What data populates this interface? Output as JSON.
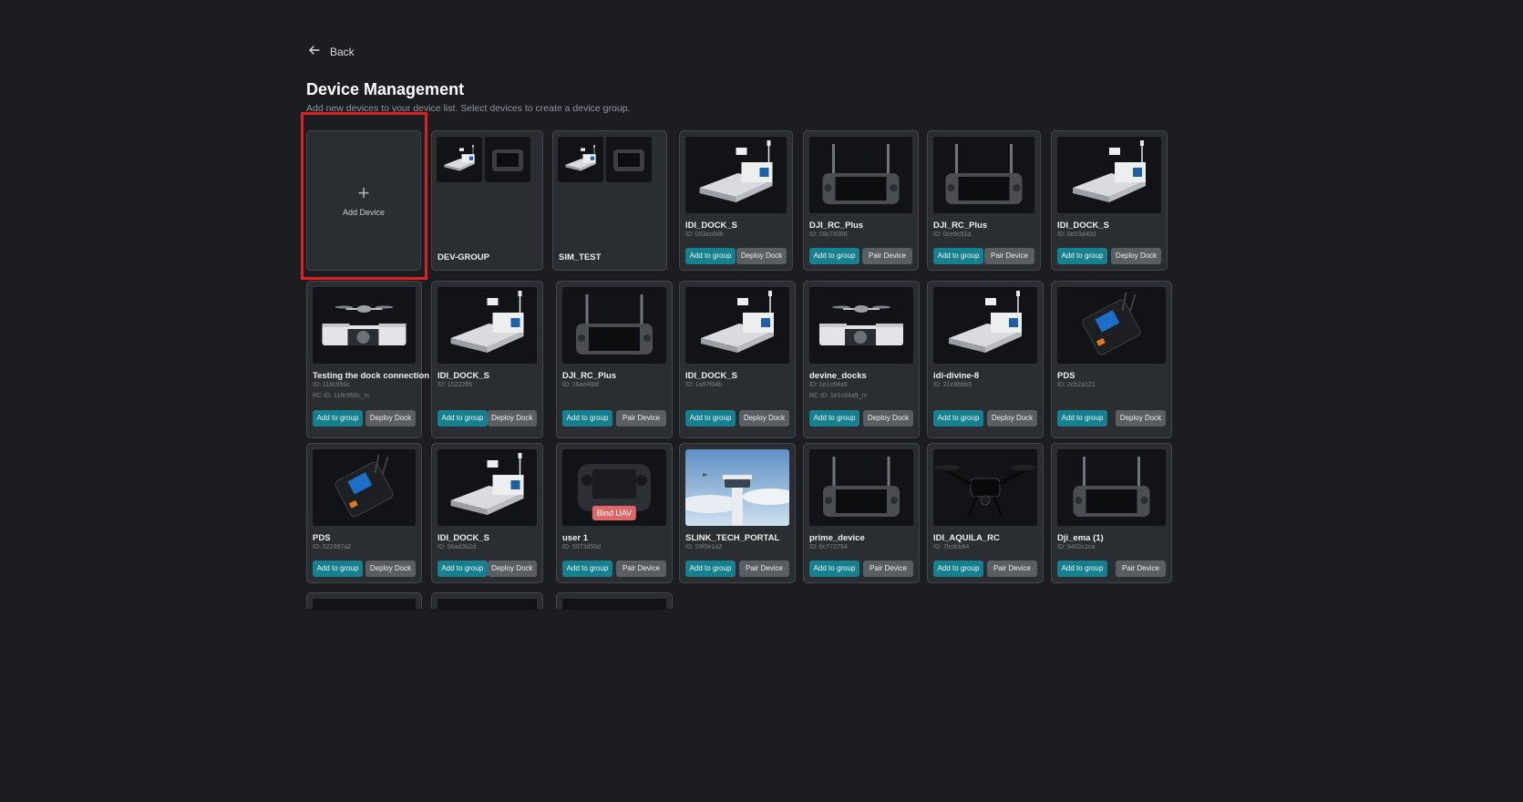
{
  "nav": {
    "back_label": "Back"
  },
  "header": {
    "title": "Device Management",
    "subtitle": "Add new devices to your device list. Select devices to create a device group."
  },
  "add_device": {
    "label": "Add Device"
  },
  "groups": [
    {
      "name": "DEV-GROUP"
    },
    {
      "name": "SIM_TEST"
    }
  ],
  "devices": [
    {
      "name": "IDI_DOCK_S",
      "id": "ID: 093ec8d6",
      "rc_id": "",
      "image": "dock-icon",
      "add_label": "Add to group",
      "action_label": "Deploy Dock"
    },
    {
      "name": "DJI_RC_Plus",
      "id": "ID: 09c78395",
      "rc_id": "",
      "image": "controller-icon",
      "add_label": "Add to group",
      "action_label": "Pair Device"
    },
    {
      "name": "DJI_RC_Plus",
      "id": "ID: 0ce9c91d",
      "rc_id": "",
      "image": "controller-icon",
      "add_label": "Add to group",
      "action_label": "Pair Device"
    },
    {
      "name": "IDI_DOCK_S",
      "id": "ID: 0e03d40d",
      "rc_id": "",
      "image": "dock-icon",
      "add_label": "Add to group",
      "action_label": "Deploy Dock"
    },
    {
      "name": "Testing the dock connection",
      "id": "ID: 118c956c",
      "rc_id": "RC ID: 118c956c_rc",
      "image": "drone-dock-icon",
      "add_label": "Add to group",
      "action_label": "Deploy Dock"
    },
    {
      "name": "IDI_DOCK_S",
      "id": "ID: 15222ff6",
      "rc_id": "",
      "image": "dock-icon",
      "add_label": "Add to group",
      "action_label": "Deploy Dock"
    },
    {
      "name": "DJI_RC_Plus",
      "id": "ID: 16ae488f",
      "rc_id": "",
      "image": "controller-icon",
      "add_label": "Add to group",
      "action_label": "Pair Device"
    },
    {
      "name": "IDI_DOCK_S",
      "id": "ID: 1a97f04b",
      "rc_id": "",
      "image": "dock-icon",
      "add_label": "Add to group",
      "action_label": "Deploy Dock"
    },
    {
      "name": "devine_docks",
      "id": "ID: 1e1c64a9",
      "rc_id": "RC ID: 1e1c64a9_rc",
      "image": "drone-dock-icon",
      "add_label": "Add to group",
      "action_label": "Deploy Dock"
    },
    {
      "name": "idi-divine-8",
      "id": "ID: 21e8bbb9",
      "rc_id": "",
      "image": "dock-icon",
      "add_label": "Add to group",
      "action_label": "Deploy Dock"
    },
    {
      "name": "PDS",
      "id": "ID: 2cb2a121",
      "rc_id": "",
      "image": "pds-icon",
      "add_label": "Add to group",
      "action_label": "Deploy Dock"
    },
    {
      "name": "PDS",
      "id": "ID: 522997a2",
      "rc_id": "",
      "image": "pds-icon",
      "add_label": "Add to group",
      "action_label": "Deploy Dock"
    },
    {
      "name": "IDI_DOCK_S",
      "id": "ID: 56ad3b2d",
      "rc_id": "",
      "image": "dock-icon",
      "add_label": "Add to group",
      "action_label": "Deploy Dock"
    },
    {
      "name": "user 1",
      "id": "ID: 5973d56d",
      "rc_id": "",
      "image": "remote-icon",
      "badge": "Bind UAV",
      "add_label": "Add to group",
      "action_label": "Pair Device"
    },
    {
      "name": "SLINK_TECH_PORTAL",
      "id": "ID: 59f0e1a2",
      "rc_id": "",
      "image": "tower-photo",
      "add_label": "Add to group",
      "action_label": "Pair Device"
    },
    {
      "name": "prime_device",
      "id": "ID: 6c772794",
      "rc_id": "",
      "image": "controller-icon",
      "add_label": "Add to group",
      "action_label": "Pair Device"
    },
    {
      "name": "IDI_AQUILA_RC",
      "id": "ID: 7fcdcb64",
      "rc_id": "",
      "image": "drone-icon",
      "add_label": "Add to group",
      "action_label": "Pair Device"
    },
    {
      "name": "Dji_ema (1)",
      "id": "ID: 9402c1ca",
      "rc_id": "",
      "image": "controller-icon",
      "add_label": "Add to group",
      "action_label": "Pair Device"
    }
  ],
  "partial_row": [
    {
      "image": "controller-icon"
    },
    {
      "image": "drone-icon"
    },
    {
      "image": "controller-icon"
    }
  ]
}
